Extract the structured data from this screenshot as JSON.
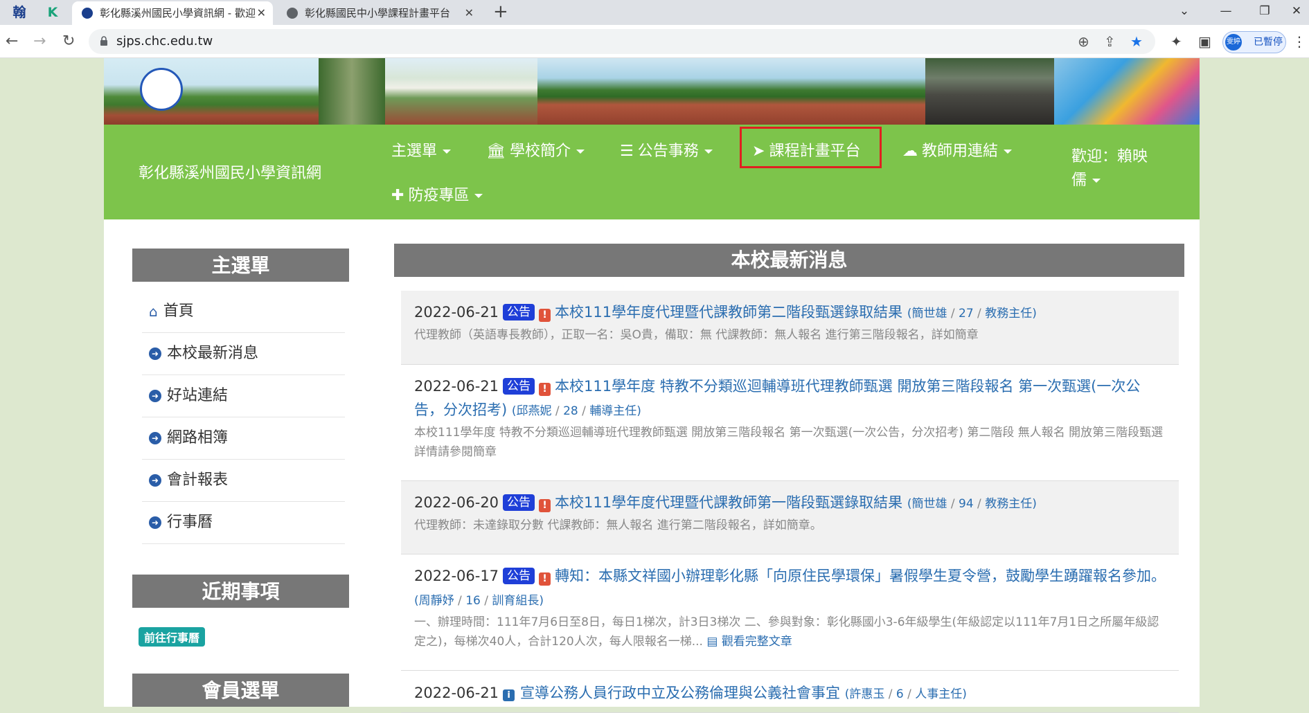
{
  "browser": {
    "pinned": [
      "翰",
      "K"
    ],
    "tabs": [
      {
        "title": "彰化縣溪州國民小學資訊網 - 歡迎",
        "active": true
      },
      {
        "title": "彰化縣國民中小學課程計畫平台",
        "active": false
      }
    ],
    "url": "sjps.chc.edu.tw",
    "profile": {
      "avatar": "雯婷",
      "status": "已暫停"
    }
  },
  "site": {
    "brand": "彰化縣溪州國民小學資訊網",
    "nav": [
      {
        "label": "主選單",
        "icon": "",
        "caret": true
      },
      {
        "label": "學校簡介",
        "icon": "bank-icon",
        "caret": true
      },
      {
        "label": "公告事務",
        "icon": "list-icon",
        "caret": true
      },
      {
        "label": "課程計畫平台",
        "icon": "paper-plane-icon",
        "caret": false,
        "highlighted": true
      },
      {
        "label": "教師用連結",
        "icon": "cloud-icon",
        "caret": true
      },
      {
        "label": "防疫專區",
        "icon": "ambulance-icon",
        "caret": true
      }
    ],
    "welcome": "歡迎：賴映儒"
  },
  "sidebar": {
    "main_title": "主選單",
    "items": [
      {
        "label": "首頁",
        "icon": "home-icon"
      },
      {
        "label": "本校最新消息",
        "icon": "arrow-circle-icon"
      },
      {
        "label": "好站連結",
        "icon": "arrow-circle-icon"
      },
      {
        "label": "網路相簿",
        "icon": "arrow-circle-icon"
      },
      {
        "label": "會計報表",
        "icon": "arrow-circle-icon"
      },
      {
        "label": "行事曆",
        "icon": "arrow-circle-icon"
      }
    ],
    "events_title": "近期事項",
    "calendar_button": "前往行事曆",
    "member_title": "會員選單"
  },
  "news": {
    "title": "本校最新消息",
    "items": [
      {
        "date": "2022-06-21",
        "badge": "公告",
        "icon": "warning-icon",
        "title": "本校111學年度代理暨代課教師第二階段甄選錄取結果",
        "author": "簡世雄",
        "views": "27",
        "role": "教務主任",
        "summary": "代理教師（英語專長教師），正取一名：吳O貴，備取：無 代課教師：無人報名 進行第三階段報名，詳如簡章",
        "readmore": ""
      },
      {
        "date": "2022-06-21",
        "badge": "公告",
        "icon": "warning-icon",
        "title": "本校111學年度 特教不分類巡迴輔導班代理教師甄選 開放第三階段報名 第一次甄選(一次公告，分次招考)",
        "author": "邱燕妮",
        "views": "28",
        "role": "輔導主任",
        "summary": "本校111學年度 特教不分類巡迴輔導班代理教師甄選 開放第三階段報名 第一次甄選(一次公告，分次招考) 第二階段 無人報名 開放第三階段甄選 詳情請參閱簡章",
        "readmore": ""
      },
      {
        "date": "2022-06-20",
        "badge": "公告",
        "icon": "warning-icon",
        "title": "本校111學年度代理暨代課教師第一階段甄選錄取結果",
        "author": "簡世雄",
        "views": "94",
        "role": "教務主任",
        "summary": "代理教師：未達錄取分數 代課教師：無人報名 進行第二階段報名，詳如簡章。",
        "readmore": ""
      },
      {
        "date": "2022-06-17",
        "badge": "公告",
        "icon": "warning-icon",
        "title": "轉知：本縣文祥國小辦理彰化縣「向原住民學環保」暑假學生夏令營，鼓勵學生踴躍報名參加。",
        "author": "周靜妤",
        "views": "16",
        "role": "訓育組長",
        "summary": "一、辦理時間：111年7月6日至8日，每日1梯次，計3日3梯次 二、參與對象：彰化縣國小3-6年級學生(年級認定以111年7月1日之所屬年級認定之)，每梯次40人，合計120人次，每人限報名一梯...",
        "readmore": "觀看完整文章"
      },
      {
        "date": "2022-06-21",
        "badge": "",
        "icon": "info-icon",
        "title": "宣導公務人員行政中立及公務倫理與公義社會事宜",
        "author": "許惠玉",
        "views": "6",
        "role": "人事主任",
        "summary": "",
        "readmore": ""
      }
    ]
  }
}
